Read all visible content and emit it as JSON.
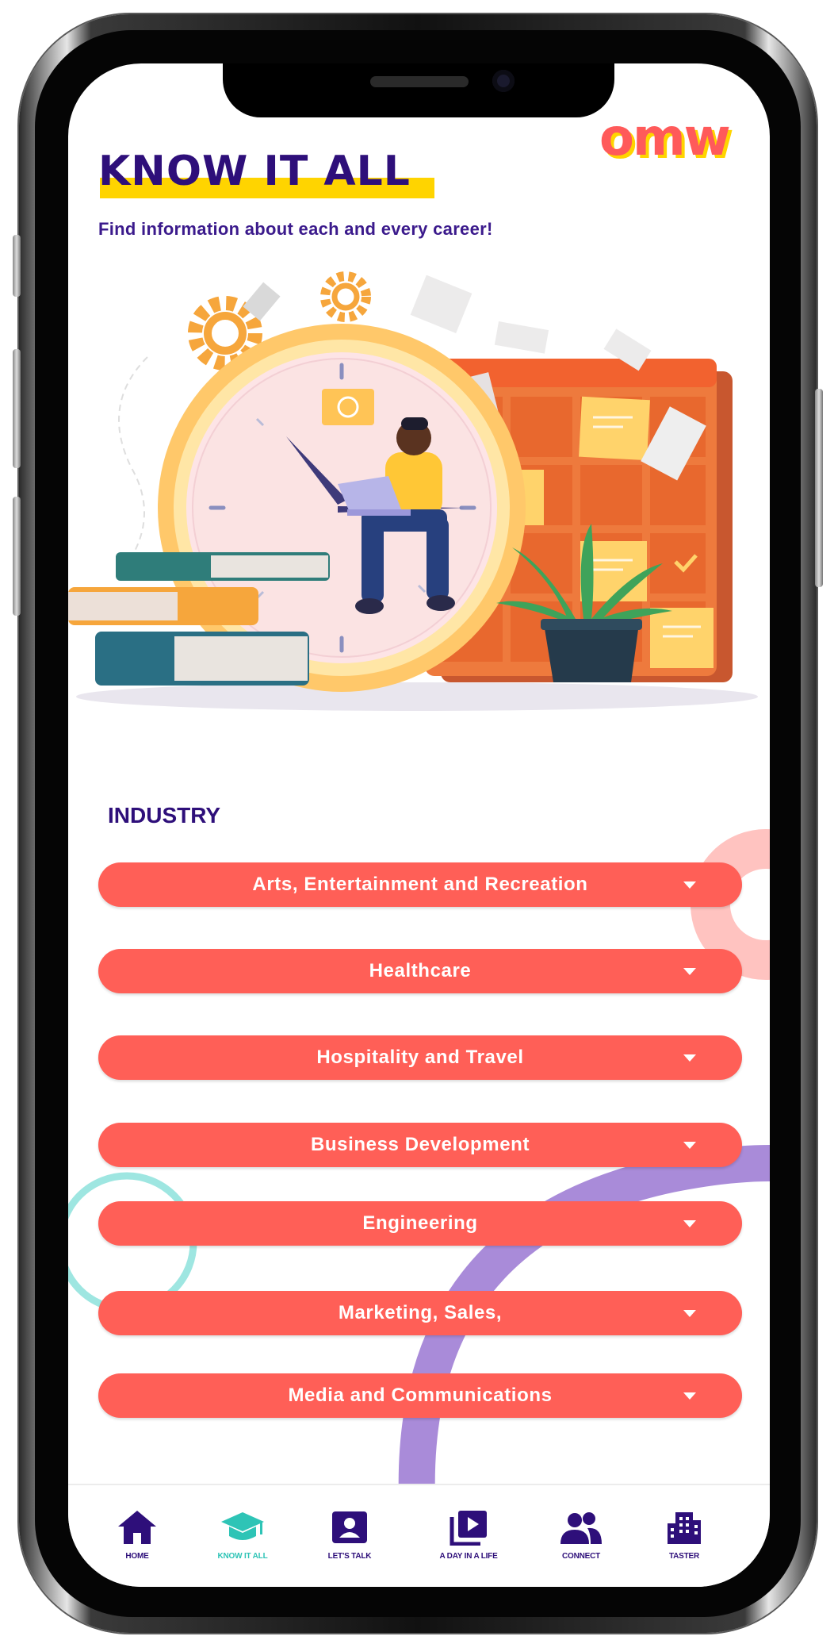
{
  "app": {
    "logo": "omw"
  },
  "header": {
    "title": "KNOW IT ALL",
    "subtitle": "Find information about each and every career!"
  },
  "industry": {
    "heading": "INDUSTRY",
    "items": [
      {
        "label": "Arts, Entertainment and Recreation"
      },
      {
        "label": "Healthcare"
      },
      {
        "label": "Hospitality and Travel"
      },
      {
        "label": "Business Development"
      },
      {
        "label": "Engineering"
      },
      {
        "label": "Marketing, Sales,"
      },
      {
        "label": "Media and Communications"
      }
    ]
  },
  "nav": {
    "active": "KNOW IT ALL",
    "items": [
      {
        "label": "HOME",
        "icon": "home-icon"
      },
      {
        "label": "KNOW IT ALL",
        "icon": "graduation-cap-icon"
      },
      {
        "label": "LET'S TALK",
        "icon": "contact-card-icon"
      },
      {
        "label": "A DAY IN A LIFE",
        "icon": "video-library-icon"
      },
      {
        "label": "CONNECT",
        "icon": "people-icon"
      },
      {
        "label": "TASTER",
        "icon": "building-icon"
      }
    ]
  },
  "colors": {
    "primary": "#2e0f7a",
    "accent": "#ff5f57",
    "highlight": "#ffd400",
    "active_nav": "#2ec4b6"
  }
}
